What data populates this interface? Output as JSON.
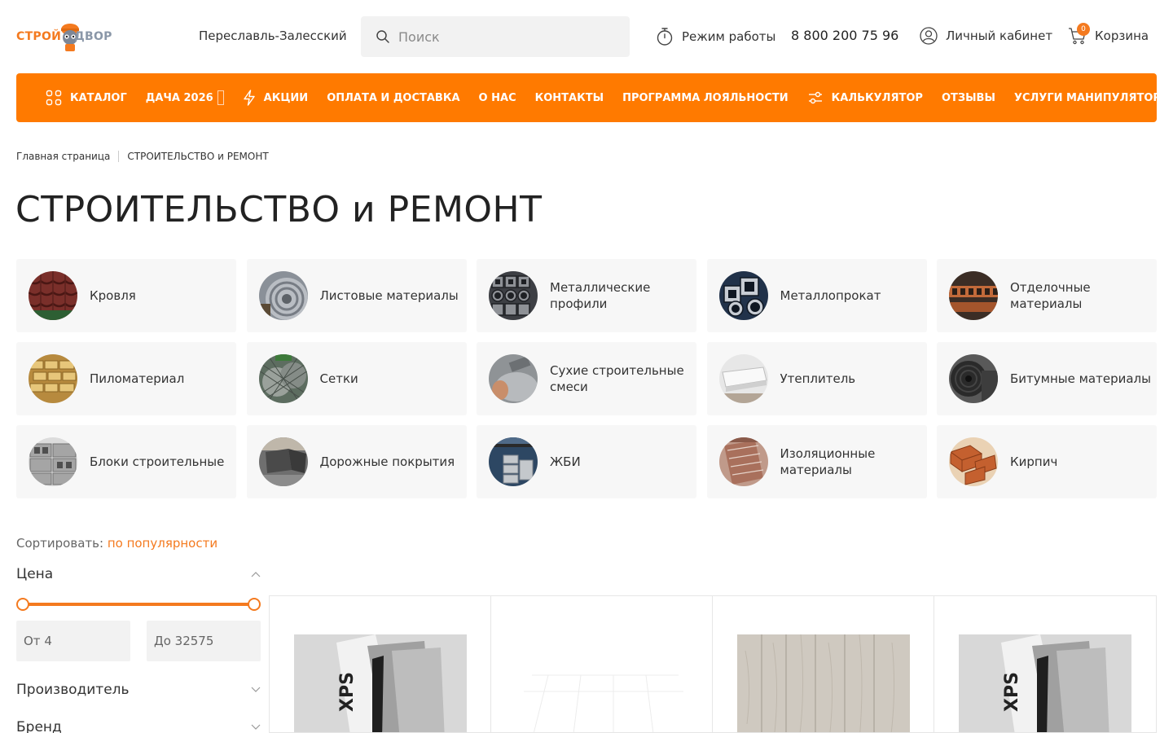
{
  "header": {
    "logo_part1": "СТРОЙ",
    "logo_part2": "ДВОР",
    "city": "Переславль-Залесский",
    "search_placeholder": "Поиск",
    "work_hours": "Режим работы",
    "phone": "8 800 200 75 96",
    "account": "Личный кабинет",
    "cart": "Корзина",
    "cart_count": "0"
  },
  "nav": {
    "items": [
      {
        "label": "КАТАЛОГ",
        "icon": "grid-icon"
      },
      {
        "label": "ДАЧА 2026",
        "icon": ""
      },
      {
        "label": "АКЦИИ",
        "icon": "lightning-icon"
      },
      {
        "label": "ОПЛАТА И ДОСТАВКА",
        "icon": ""
      },
      {
        "label": "О НАС",
        "icon": ""
      },
      {
        "label": "КОНТАКТЫ",
        "icon": ""
      },
      {
        "label": "ПРОГРАММА ЛОЯЛЬНОСТИ",
        "icon": ""
      },
      {
        "label": "КАЛЬКУЛЯТОР",
        "icon": "sliders-icon"
      },
      {
        "label": "ОТЗЫВЫ",
        "icon": ""
      },
      {
        "label": "УСЛУГИ МАНИПУЛЯТОРА",
        "icon": ""
      }
    ]
  },
  "breadcrumb": {
    "home": "Главная страница",
    "current": "СТРОИТЕЛЬСТВО и РЕМОНТ"
  },
  "page_title": "СТРОИТЕЛЬСТВО и РЕМОНТ",
  "categories": [
    {
      "label": "Кровля"
    },
    {
      "label": "Листовые материалы"
    },
    {
      "label": "Металлические профили"
    },
    {
      "label": "Металлопрокат"
    },
    {
      "label": "Отделочные материалы"
    },
    {
      "label": "Пиломатериал"
    },
    {
      "label": "Сетки"
    },
    {
      "label": "Сухие строительные смеси"
    },
    {
      "label": "Утеплитель"
    },
    {
      "label": "Битумные материалы"
    },
    {
      "label": "Блоки строительные"
    },
    {
      "label": "Дорожные покрытия"
    },
    {
      "label": "ЖБИ"
    },
    {
      "label": "Изоляционные материалы"
    },
    {
      "label": "Кирпич"
    }
  ],
  "sort": {
    "label": "Сортировать:",
    "value": "по популярности"
  },
  "filters": {
    "price_title": "Цена",
    "price_from": "От 4",
    "price_to": "До 32575",
    "manufacturer_title": "Производитель",
    "brand_title": "Бренд"
  },
  "products": [
    {
      "image": "xps-insulation-pack"
    },
    {
      "image": "white-grid-panel"
    },
    {
      "image": "wood-laminate"
    },
    {
      "image": "xps-insulation-pack"
    }
  ],
  "colors": {
    "accent": "#ff7a00",
    "brand_orange": "#f47a1f",
    "tile_bg": "#f7f7f7"
  }
}
